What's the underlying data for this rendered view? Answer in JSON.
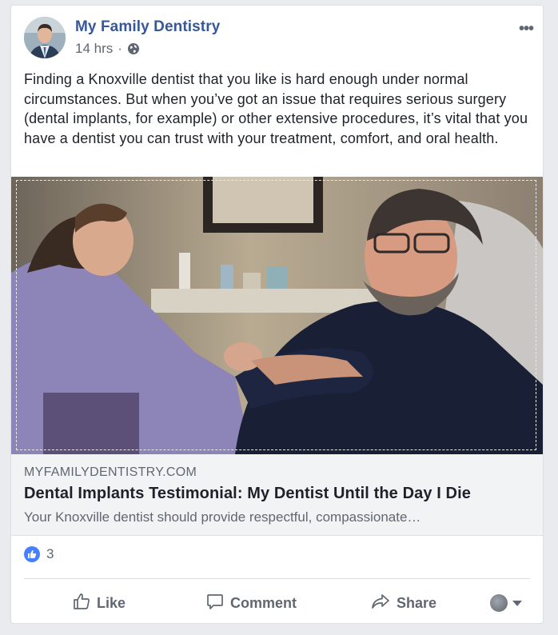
{
  "post": {
    "page_name": "My Family Dentistry",
    "time": "14 hrs",
    "separator": "·",
    "privacy_icon": "globe-icon",
    "more_icon": "more-options-icon",
    "more_label": "•••",
    "text": "Finding a Knoxville dentist that you like is hard enough under normal circumstances. But when you’ve got an issue that requires serious surgery (dental implants, for example) or other extensive procedures, it’s vital that you have a dentist you can trust with your treatment, comfort, and oral health."
  },
  "link_preview": {
    "domain": "MYFAMILYDENTISTRY.COM",
    "title": "Dental Implants Testimonial: My Dentist Until the Day I Die",
    "description": "Your Knoxville dentist should provide respectful, compassionate…"
  },
  "reactions": {
    "icon": "like-reaction-icon",
    "count": "3"
  },
  "actions": {
    "like": "Like",
    "comment": "Comment",
    "share": "Share"
  },
  "colors": {
    "page_name": "#365899",
    "like_badge": "#4680ff",
    "text": "#1d2129",
    "muted": "#606770"
  }
}
